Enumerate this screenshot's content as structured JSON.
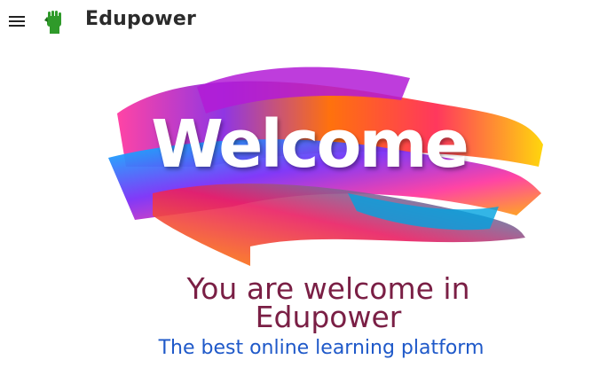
{
  "header": {
    "brand": "Edupower",
    "menu_icon": "hamburger-menu-icon",
    "logo_icon": "raised-fist-icon"
  },
  "banner": {
    "word": "Welcome"
  },
  "main": {
    "headline": "You are welcome in Edupower",
    "subheadline": "The best online learning platform"
  },
  "colors": {
    "headline": "#7a1f45",
    "subheadline": "#1f59c9",
    "logo_green": "#2f9a2a"
  }
}
